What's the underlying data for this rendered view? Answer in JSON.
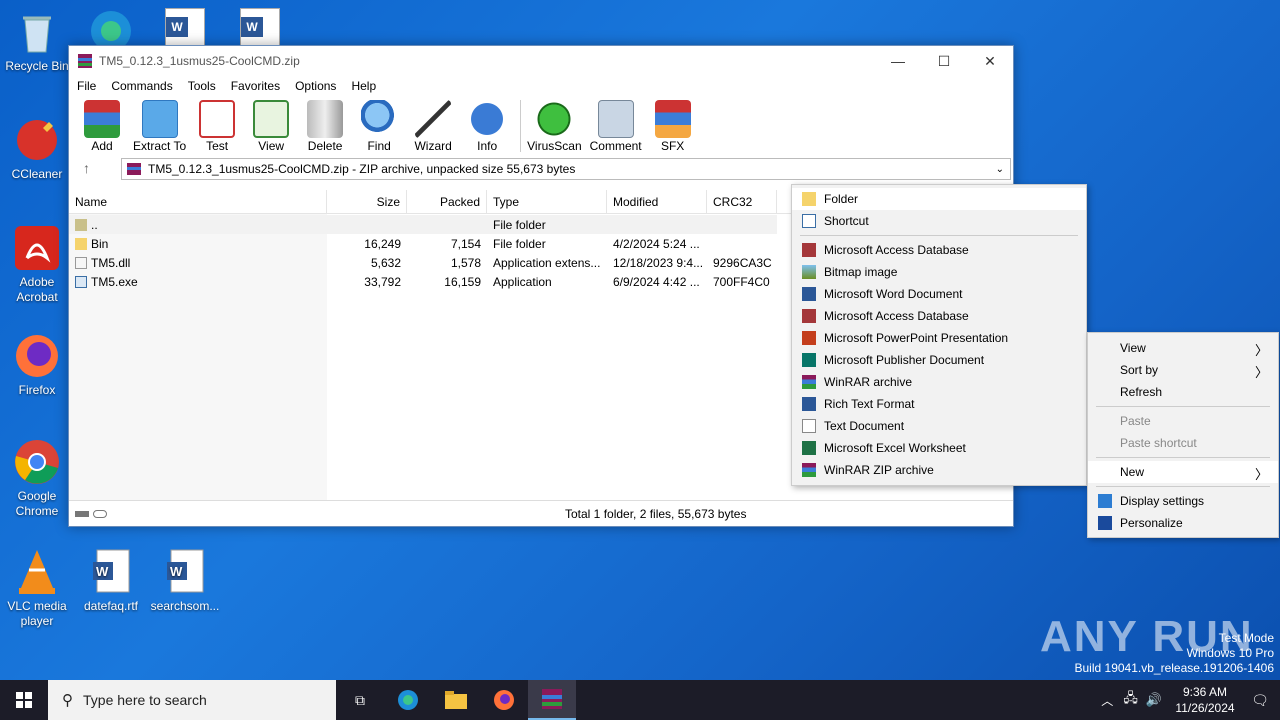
{
  "desktop": {
    "icons": [
      {
        "label": "Recycle Bin",
        "icon": "recycle-bin-icon"
      },
      {
        "label": "CCleaner",
        "icon": "ccleaner-icon"
      },
      {
        "label": "Adobe Acrobat",
        "icon": "acrobat-icon"
      },
      {
        "label": "Firefox",
        "icon": "firefox-icon"
      },
      {
        "label": "Google Chrome",
        "icon": "chrome-icon"
      },
      {
        "label": "VLC media player",
        "icon": "vlc-icon"
      },
      {
        "label": "datefaq.rtf",
        "icon": "word-doc-icon"
      },
      {
        "label": "searchsom...",
        "icon": "word-doc-icon"
      }
    ]
  },
  "window": {
    "title": "TM5_0.12.3_1usmus25-CoolCMD.zip",
    "menu": [
      "File",
      "Commands",
      "Tools",
      "Favorites",
      "Options",
      "Help"
    ],
    "toolbar": [
      "Add",
      "Extract To",
      "Test",
      "View",
      "Delete",
      "Find",
      "Wizard",
      "Info",
      "VirusScan",
      "Comment",
      "SFX"
    ],
    "address": "TM5_0.12.3_1usmus25-CoolCMD.zip - ZIP archive, unpacked size 55,673 bytes",
    "columns": [
      "Name",
      "Size",
      "Packed",
      "Type",
      "Modified",
      "CRC32"
    ],
    "rows": [
      {
        "name": "..",
        "size": "",
        "packed": "",
        "type": "File folder",
        "modified": "",
        "crc": ""
      },
      {
        "name": "Bin",
        "size": "16,249",
        "packed": "7,154",
        "type": "File folder",
        "modified": "4/2/2024 5:24 ...",
        "crc": ""
      },
      {
        "name": "TM5.dll",
        "size": "5,632",
        "packed": "1,578",
        "type": "Application extens...",
        "modified": "12/18/2023 9:4...",
        "crc": "9296CA3C"
      },
      {
        "name": "TM5.exe",
        "size": "33,792",
        "packed": "16,159",
        "type": "Application",
        "modified": "6/9/2024 4:42 ...",
        "crc": "700FF4C0"
      }
    ],
    "status": "Total 1 folder, 2 files, 55,673 bytes"
  },
  "new_menu": {
    "items": [
      "Folder",
      "Shortcut",
      "Microsoft Access Database",
      "Bitmap image",
      "Microsoft Word Document",
      "Microsoft Access Database",
      "Microsoft PowerPoint Presentation",
      "Microsoft Publisher Document",
      "WinRAR archive",
      "Rich Text Format",
      "Text Document",
      "Microsoft Excel Worksheet",
      "WinRAR ZIP archive"
    ]
  },
  "context_menu": {
    "view": "View",
    "sort_by": "Sort by",
    "refresh": "Refresh",
    "paste": "Paste",
    "paste_shortcut": "Paste shortcut",
    "new": "New",
    "display_settings": "Display settings",
    "personalize": "Personalize"
  },
  "taskbar": {
    "search_placeholder": "Type here to search",
    "time": "9:36 AM",
    "date": "11/26/2024"
  },
  "watermark": {
    "brand": "ANY RUN",
    "line1": "Test Mode",
    "line2": "Windows 10 Pro",
    "line3": "Build 19041.vb_release.191206-1406"
  }
}
